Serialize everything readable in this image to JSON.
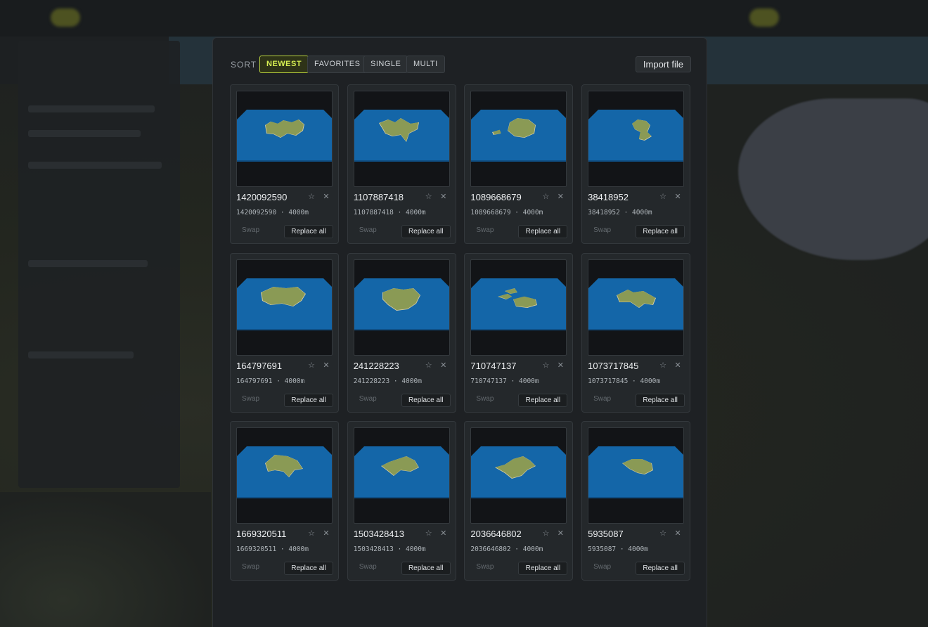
{
  "toolbar": {
    "sort_label": "SORT",
    "filters": [
      {
        "label": "NEWEST",
        "active": true
      },
      {
        "label": "FAVORITES",
        "active": false
      },
      {
        "label": "SINGLE",
        "active": false
      },
      {
        "label": "MULTI",
        "active": false
      }
    ],
    "import_label": "Import file"
  },
  "colors": {
    "accent": "#d7ef52",
    "ocean": "#1466a8",
    "land": "#8a9a55",
    "sand": "#d9cfa6"
  },
  "icons": {
    "favorite": "star-icon",
    "delete": "close-icon"
  },
  "maps": [
    {
      "title": "1420092590",
      "meta": "1420092590 · 4000m",
      "swap": "Swap",
      "replace": "Replace all"
    },
    {
      "title": "1107887418",
      "meta": "1107887418 · 4000m",
      "swap": "Swap",
      "replace": "Replace all"
    },
    {
      "title": "1089668679",
      "meta": "1089668679 · 4000m",
      "swap": "Swap",
      "replace": "Replace all"
    },
    {
      "title": "38418952",
      "meta": "38418952 · 4000m",
      "swap": "Swap",
      "replace": "Replace all"
    },
    {
      "title": "164797691",
      "meta": "164797691 · 4000m",
      "swap": "Swap",
      "replace": "Replace all"
    },
    {
      "title": "241228223",
      "meta": "241228223 · 4000m",
      "swap": "Swap",
      "replace": "Replace all"
    },
    {
      "title": "710747137",
      "meta": "710747137 · 4000m",
      "swap": "Swap",
      "replace": "Replace all"
    },
    {
      "title": "1073717845",
      "meta": "1073717845 · 4000m",
      "swap": "Swap",
      "replace": "Replace all"
    },
    {
      "title": "1669320511",
      "meta": "1669320511 · 4000m",
      "swap": "Swap",
      "replace": "Replace all"
    },
    {
      "title": "1503428413",
      "meta": "1503428413 · 4000m",
      "swap": "Swap",
      "replace": "Replace all"
    },
    {
      "title": "2036646802",
      "meta": "2036646802 · 4000m",
      "swap": "Swap",
      "replace": "Replace all"
    },
    {
      "title": "5935087",
      "meta": "5935087 · 4000m",
      "swap": "Swap",
      "replace": "Replace all"
    }
  ]
}
